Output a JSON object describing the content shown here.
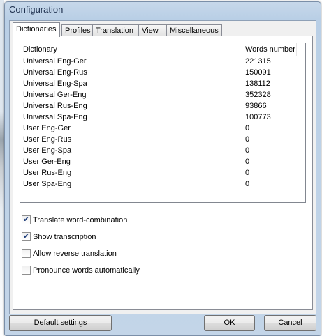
{
  "window": {
    "title": "Configuration"
  },
  "tabs": [
    {
      "label": "Dictionaries"
    },
    {
      "label": "Profiles"
    },
    {
      "label": "Translation"
    },
    {
      "label": "View"
    },
    {
      "label": "Miscellaneous"
    }
  ],
  "dictionary_list": {
    "columns": [
      "Dictionary",
      "Words number"
    ],
    "rows": [
      {
        "name": "Universal Eng-Ger",
        "words": "221315"
      },
      {
        "name": "Universal Eng-Rus",
        "words": "150091"
      },
      {
        "name": "Universal Eng-Spa",
        "words": "138112"
      },
      {
        "name": "Universal Ger-Eng",
        "words": "352328"
      },
      {
        "name": "Universal Rus-Eng",
        "words": "93866"
      },
      {
        "name": "Universal Spa-Eng",
        "words": "100773"
      },
      {
        "name": "User Eng-Ger",
        "words": "0"
      },
      {
        "name": "User Eng-Rus",
        "words": "0"
      },
      {
        "name": "User Eng-Spa",
        "words": "0"
      },
      {
        "name": "User Ger-Eng",
        "words": "0"
      },
      {
        "name": "User Rus-Eng",
        "words": "0"
      },
      {
        "name": "User Spa-Eng",
        "words": "0"
      }
    ]
  },
  "options": [
    {
      "label": "Translate word-combination",
      "checked": true
    },
    {
      "label": "Show transcription",
      "checked": true
    },
    {
      "label": "Allow reverse translation",
      "checked": false
    },
    {
      "label": "Pronounce words automatically",
      "checked": false
    }
  ],
  "buttons": {
    "default_settings": "Default settings",
    "ok": "OK",
    "cancel": "Cancel"
  }
}
